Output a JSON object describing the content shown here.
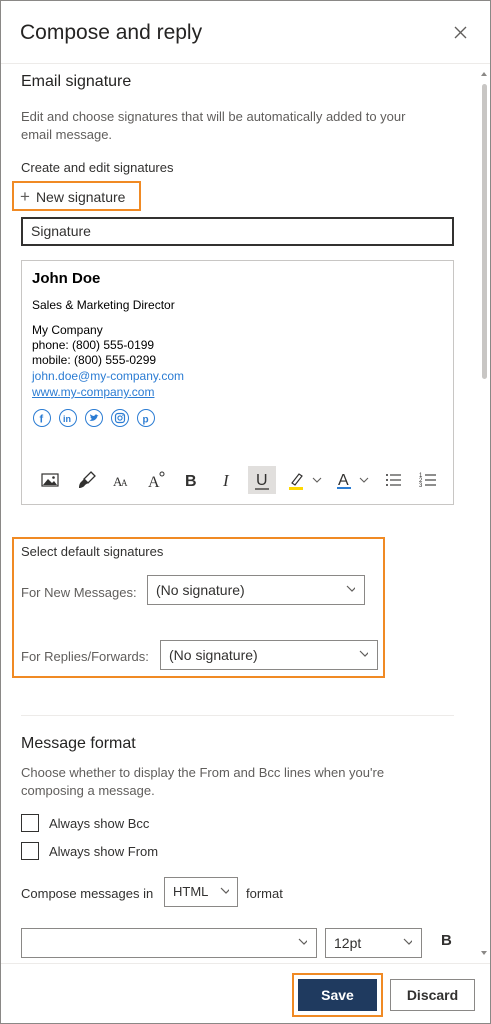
{
  "panel": {
    "title": "Compose and reply"
  },
  "signature": {
    "heading": "Email signature",
    "description_line1": "Edit and choose signatures that will be automatically added to your",
    "description_line2": "email message.",
    "create_label": "Create and edit signatures",
    "new_signature_label": "New signature",
    "name_value": "Signature",
    "content": {
      "name": "John Doe",
      "title": "Sales & Marketing Director",
      "company": "My Company",
      "phone": "phone: (800) 555-0199",
      "mobile": "mobile: (800) 555-0299",
      "email": "john.doe@my-company.com",
      "website": "www.my-company.com"
    },
    "social_icons": [
      "facebook-icon",
      "linkedin-icon",
      "twitter-icon",
      "instagram-icon",
      "pinterest-icon"
    ],
    "toolbar": {
      "insert_picture": "picture-icon",
      "format_painter": "format-painter-icon",
      "font_size_decrease": "A",
      "font_size_increase": "A",
      "bold": "B",
      "italic": "I",
      "underline": "U",
      "font_color": "A"
    }
  },
  "defaults": {
    "heading": "Select default signatures",
    "new_messages_label": "For New Messages:",
    "new_messages_value": "(No signature)",
    "replies_label": "For Replies/Forwards:",
    "replies_value": "(No signature)"
  },
  "format": {
    "heading": "Message format",
    "description_line1": "Choose whether to display the From and Bcc lines when you're",
    "description_line2": "composing a message.",
    "always_bcc": "Always show Bcc",
    "always_from": "Always show From",
    "compose_prefix": "Compose messages in",
    "compose_value": "HTML",
    "compose_suffix": "format",
    "font_value": "",
    "size_value": "12pt",
    "bold": "B"
  },
  "footer": {
    "save": "Save",
    "discard": "Discard"
  },
  "colors": {
    "accent": "#f08a24",
    "primary": "#1f3a5f",
    "link": "#2b7cd3",
    "highlight": "#ffd800"
  }
}
